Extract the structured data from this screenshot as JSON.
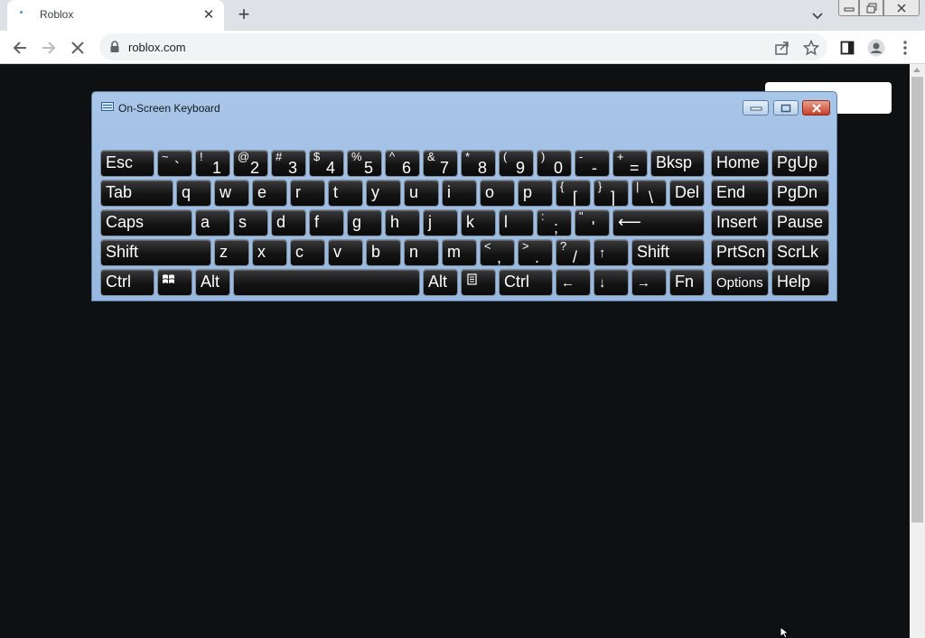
{
  "browser": {
    "tab_title": "Roblox",
    "url": "roblox.com"
  },
  "osk": {
    "title": "On-Screen Keyboard"
  },
  "keys": [
    {
      "id": "esc",
      "label": "Esc"
    },
    {
      "id": "backtick",
      "shift": "~",
      "base": "`"
    },
    {
      "id": "1",
      "shift": "!",
      "base": "1"
    },
    {
      "id": "2",
      "shift": "@",
      "base": "2"
    },
    {
      "id": "3",
      "shift": "#",
      "base": "3"
    },
    {
      "id": "4",
      "shift": "$",
      "base": "4"
    },
    {
      "id": "5",
      "shift": "%",
      "base": "5"
    },
    {
      "id": "6",
      "shift": "^",
      "base": "6"
    },
    {
      "id": "7",
      "shift": "&",
      "base": "7"
    },
    {
      "id": "8",
      "shift": "*",
      "base": "8"
    },
    {
      "id": "9",
      "shift": "(",
      "base": "9"
    },
    {
      "id": "0",
      "shift": ")",
      "base": "0"
    },
    {
      "id": "minus",
      "shift": "-",
      "base": "-"
    },
    {
      "id": "equals",
      "shift": "+",
      "base": "="
    },
    {
      "id": "bksp",
      "label": "Bksp"
    },
    {
      "id": "home",
      "label": "Home"
    },
    {
      "id": "pgup",
      "label": "PgUp"
    },
    {
      "id": "tab",
      "label": "Tab"
    },
    {
      "id": "q",
      "label": "q"
    },
    {
      "id": "w",
      "label": "w"
    },
    {
      "id": "e",
      "label": "e"
    },
    {
      "id": "r",
      "label": "r"
    },
    {
      "id": "t",
      "label": "t"
    },
    {
      "id": "y",
      "label": "y"
    },
    {
      "id": "u",
      "label": "u"
    },
    {
      "id": "i",
      "label": "i"
    },
    {
      "id": "o",
      "label": "o"
    },
    {
      "id": "p",
      "label": "p"
    },
    {
      "id": "lbracket",
      "shift": "{",
      "base": "["
    },
    {
      "id": "rbracket",
      "shift": "}",
      "base": "]"
    },
    {
      "id": "backslash",
      "shift": "|",
      "base": "\\"
    },
    {
      "id": "del",
      "label": "Del"
    },
    {
      "id": "end",
      "label": "End"
    },
    {
      "id": "pgdn",
      "label": "PgDn"
    },
    {
      "id": "caps",
      "label": "Caps"
    },
    {
      "id": "a",
      "label": "a"
    },
    {
      "id": "s",
      "label": "s"
    },
    {
      "id": "d",
      "label": "d"
    },
    {
      "id": "f",
      "label": "f"
    },
    {
      "id": "g",
      "label": "g"
    },
    {
      "id": "h",
      "label": "h"
    },
    {
      "id": "j",
      "label": "j"
    },
    {
      "id": "k",
      "label": "k"
    },
    {
      "id": "l",
      "label": "l"
    },
    {
      "id": "semicolon",
      "shift": ":",
      "base": ";"
    },
    {
      "id": "quote",
      "shift": "\"",
      "base": "'"
    },
    {
      "id": "enter",
      "label": "⟵"
    },
    {
      "id": "insert",
      "label": "Insert"
    },
    {
      "id": "pause",
      "label": "Pause"
    },
    {
      "id": "lshift",
      "label": "Shift"
    },
    {
      "id": "z",
      "label": "z"
    },
    {
      "id": "x",
      "label": "x"
    },
    {
      "id": "c",
      "label": "c"
    },
    {
      "id": "v",
      "label": "v"
    },
    {
      "id": "b",
      "label": "b"
    },
    {
      "id": "n",
      "label": "n"
    },
    {
      "id": "m",
      "label": "m"
    },
    {
      "id": "comma",
      "shift": "<",
      "base": ","
    },
    {
      "id": "period",
      "shift": ">",
      "base": "."
    },
    {
      "id": "slash",
      "shift": "?",
      "base": "/"
    },
    {
      "id": "up",
      "label": "↑"
    },
    {
      "id": "rshift",
      "label": "Shift"
    },
    {
      "id": "prtscn",
      "label": "PrtScn"
    },
    {
      "id": "scrlk",
      "label": "ScrLk"
    },
    {
      "id": "lctrl",
      "label": "Ctrl"
    },
    {
      "id": "win",
      "label": ""
    },
    {
      "id": "lalt",
      "label": "Alt"
    },
    {
      "id": "space",
      "label": ""
    },
    {
      "id": "ralt",
      "label": "Alt"
    },
    {
      "id": "menu",
      "label": ""
    },
    {
      "id": "rctrl",
      "label": "Ctrl"
    },
    {
      "id": "left",
      "label": "←"
    },
    {
      "id": "down",
      "label": "↓"
    },
    {
      "id": "right",
      "label": "→"
    },
    {
      "id": "fn",
      "label": "Fn"
    },
    {
      "id": "options",
      "label": "Options"
    },
    {
      "id": "help",
      "label": "Help"
    }
  ]
}
